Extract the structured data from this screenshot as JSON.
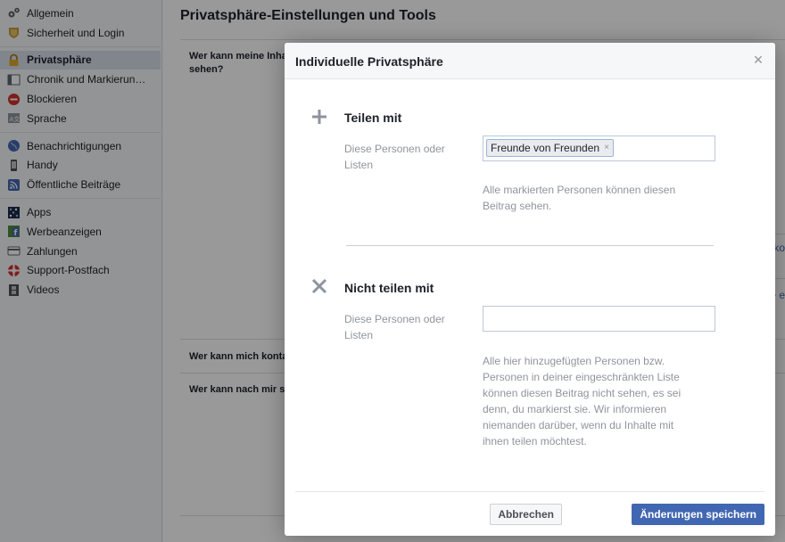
{
  "sidebar": {
    "groups": [
      [
        {
          "label": "Allgemein",
          "icon": "gears-icon"
        },
        {
          "label": "Sicherheit und Login",
          "icon": "badge-icon"
        }
      ],
      [
        {
          "label": "Privatsphäre",
          "icon": "lock-icon",
          "active": true
        },
        {
          "label": "Chronik und Markierun…",
          "icon": "timeline-icon"
        },
        {
          "label": "Blockieren",
          "icon": "block-icon"
        },
        {
          "label": "Sprache",
          "icon": "language-icon"
        }
      ],
      [
        {
          "label": "Benachrichtigungen",
          "icon": "globe-icon"
        },
        {
          "label": "Handy",
          "icon": "phone-icon"
        },
        {
          "label": "Öffentliche Beiträge",
          "icon": "rss-icon"
        }
      ],
      [
        {
          "label": "Apps",
          "icon": "apps-icon"
        },
        {
          "label": "Werbeanzeigen",
          "icon": "ads-icon"
        },
        {
          "label": "Zahlungen",
          "icon": "card-icon"
        },
        {
          "label": "Support-Postfach",
          "icon": "lifebuoy-icon"
        },
        {
          "label": "Videos",
          "icon": "film-icon"
        }
      ]
    ]
  },
  "main": {
    "title": "Privatsphäre-Einstellungen und Tools",
    "rows": [
      {
        "question": "Wer kann meine Inha… sehen?",
        "q1": "Wer kann meine Inha",
        "q2": "sehen?"
      },
      {
        "question": "Wer kann mich konta"
      },
      {
        "question": "Wer kann nach mir s"
      }
    ],
    "edge_texts": [
      "ko",
      "e e"
    ]
  },
  "dialog": {
    "title": "Individuelle Privatsphäre",
    "close_symbol": "×",
    "share": {
      "title": "Teilen mit",
      "label": "Diese Personen oder Listen",
      "token": "Freunde von Freunden",
      "token_remove": "×",
      "help": "Alle markierten Personen können diesen Beitrag sehen."
    },
    "dont_share": {
      "title": "Nicht teilen mit",
      "label": "Diese Personen oder Listen",
      "value": "",
      "help": "Alle hier hinzugefügten Personen bzw. Personen in deiner eingeschränkten Liste können diesen Beitrag nicht sehen, es sei denn, du markierst sie. Wir informieren niemanden darüber, wenn du Inhalte mit ihnen teilen möchtest."
    },
    "buttons": {
      "cancel": "Abbrechen",
      "save": "Änderungen speichern"
    }
  },
  "colors": {
    "accent": "#4267b2",
    "sidebar_active": "#d8dfea",
    "overlay": "rgba(0,0,0,0.4)"
  }
}
